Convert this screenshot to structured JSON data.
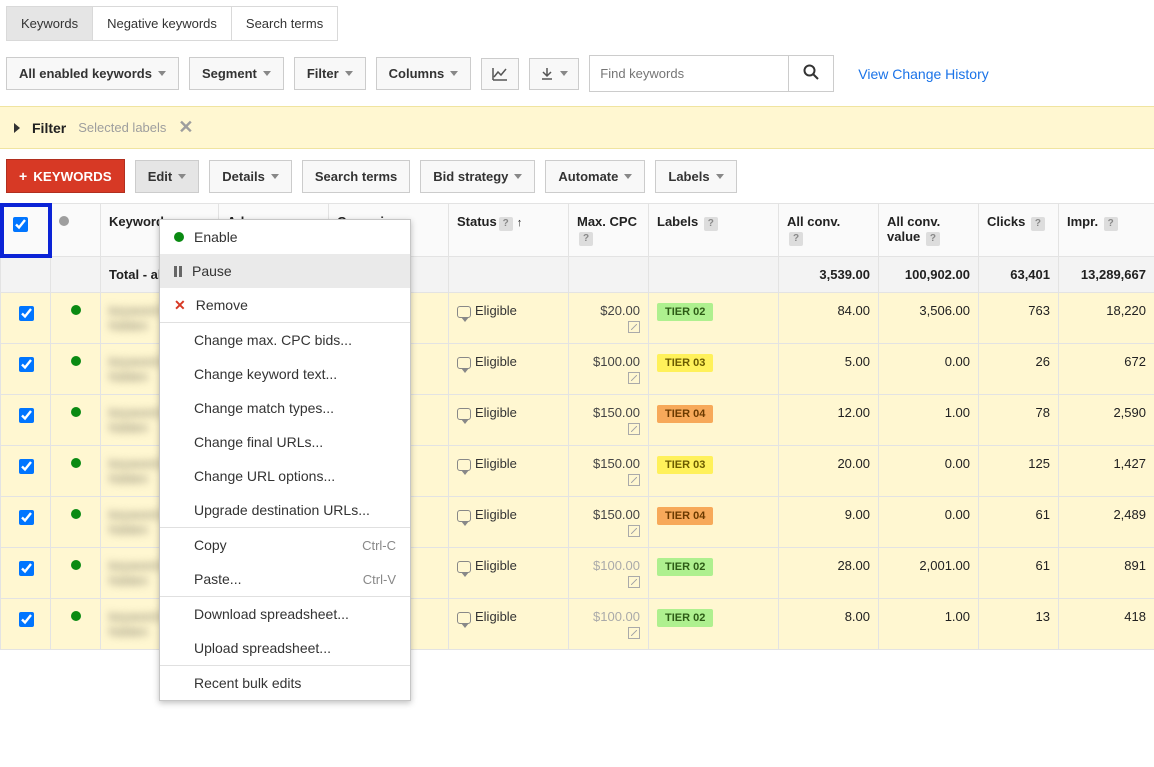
{
  "tabs": {
    "keywords": "Keywords",
    "negative": "Negative keywords",
    "search_terms": "Search terms"
  },
  "toolbar": {
    "all_enabled": "All enabled keywords",
    "segment": "Segment",
    "filter": "Filter",
    "columns": "Columns",
    "search_placeholder": "Find keywords",
    "view_history": "View Change History"
  },
  "filter_bar": {
    "label": "Filter",
    "selected": "Selected labels"
  },
  "action_row": {
    "keywords_btn": "KEYWORDS",
    "edit": "Edit",
    "details": "Details",
    "search_terms": "Search terms",
    "bid_strategy": "Bid strategy",
    "automate": "Automate",
    "labels": "Labels"
  },
  "edit_menu": {
    "enable": "Enable",
    "pause": "Pause",
    "remove": "Remove",
    "change_cpc": "Change max. CPC bids...",
    "change_text": "Change keyword text...",
    "change_match": "Change match types...",
    "change_final": "Change final URLs...",
    "change_url_opt": "Change URL options...",
    "upgrade_dest": "Upgrade destination URLs...",
    "copy": "Copy",
    "copy_sc": "Ctrl-C",
    "paste": "Paste...",
    "paste_sc": "Ctrl-V",
    "download": "Download spreadsheet...",
    "upload": "Upload spreadsheet...",
    "recent": "Recent bulk edits"
  },
  "columns": {
    "keyword": "Keyword",
    "adgroup": "Ad group",
    "campaign": "Campaign",
    "status": "Status",
    "max_cpc": "Max. CPC",
    "labels": "Labels",
    "all_conv": "All conv.",
    "all_conv_value": "All conv. value",
    "clicks": "Clicks",
    "impr": "Impr."
  },
  "totals_label": "Total - all account",
  "totals": {
    "all_conv": "3,539.00",
    "all_conv_value": "100,902.00",
    "clicks": "63,401",
    "impr": "13,289,667"
  },
  "rows": [
    {
      "status": "Eligible",
      "cpc": "$20.00",
      "cpc_muted": false,
      "tier": "TIER 02",
      "tier_class": "t02",
      "all_conv": "84.00",
      "value": "3,506.00",
      "clicks": "763",
      "impr": "18,220"
    },
    {
      "status": "Eligible",
      "cpc": "$100.00",
      "cpc_muted": false,
      "tier": "TIER 03",
      "tier_class": "t03",
      "all_conv": "5.00",
      "value": "0.00",
      "clicks": "26",
      "impr": "672"
    },
    {
      "status": "Eligible",
      "cpc": "$150.00",
      "cpc_muted": false,
      "tier": "TIER 04",
      "tier_class": "t04",
      "all_conv": "12.00",
      "value": "1.00",
      "clicks": "78",
      "impr": "2,590"
    },
    {
      "status": "Eligible",
      "cpc": "$150.00",
      "cpc_muted": false,
      "tier": "TIER 03",
      "tier_class": "t03",
      "all_conv": "20.00",
      "value": "0.00",
      "clicks": "125",
      "impr": "1,427"
    },
    {
      "status": "Eligible",
      "cpc": "$150.00",
      "cpc_muted": false,
      "tier": "TIER 04",
      "tier_class": "t04",
      "all_conv": "9.00",
      "value": "0.00",
      "clicks": "61",
      "impr": "2,489"
    },
    {
      "status": "Eligible",
      "cpc": "$100.00",
      "cpc_muted": true,
      "tier": "TIER 02",
      "tier_class": "t02",
      "all_conv": "28.00",
      "value": "2,001.00",
      "clicks": "61",
      "impr": "891"
    },
    {
      "status": "Eligible",
      "cpc": "$100.00",
      "cpc_muted": true,
      "tier": "TIER 02",
      "tier_class": "t02",
      "all_conv": "8.00",
      "value": "1.00",
      "clicks": "13",
      "impr": "418"
    }
  ]
}
